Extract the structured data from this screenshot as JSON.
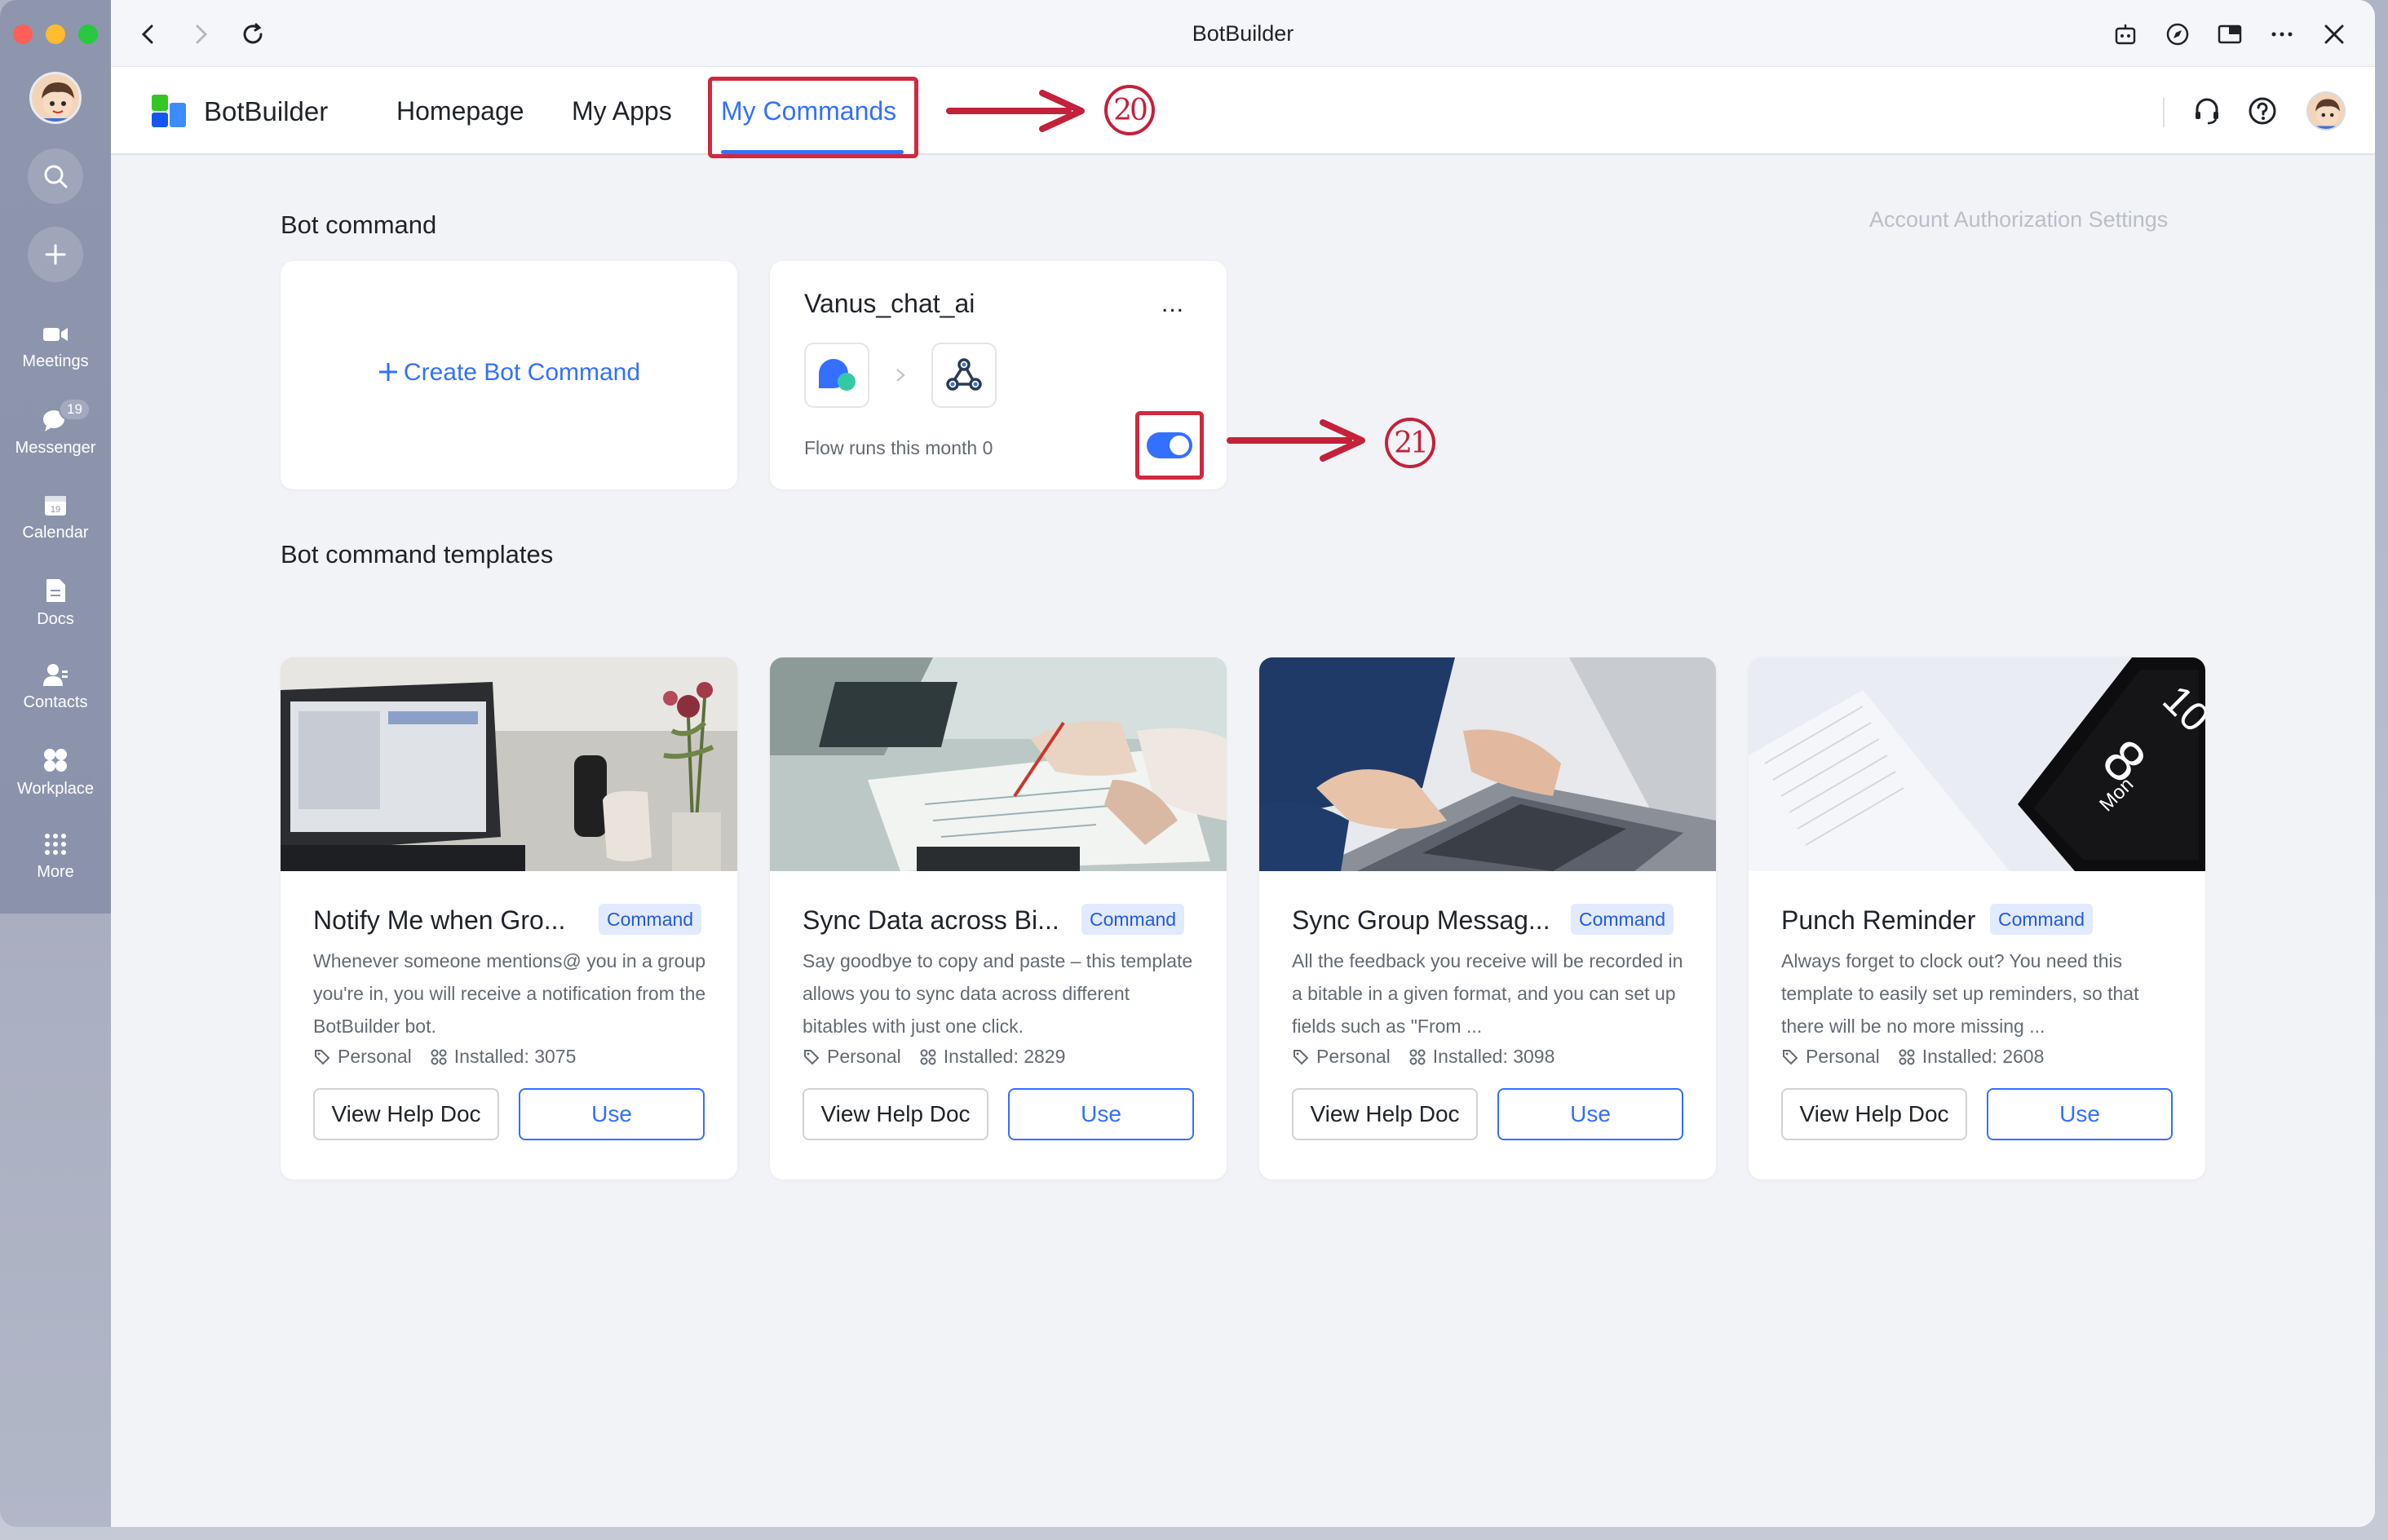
{
  "window": {
    "title": "BotBuilder"
  },
  "sidebar": {
    "items": [
      {
        "label": "Meetings",
        "icon": "video-icon"
      },
      {
        "label": "Messenger",
        "icon": "chat-icon",
        "badge": "19"
      },
      {
        "label": "Calendar",
        "icon": "calendar-icon",
        "day": "19"
      },
      {
        "label": "Docs",
        "icon": "docs-icon"
      },
      {
        "label": "Contacts",
        "icon": "contacts-icon"
      },
      {
        "label": "Workplace",
        "icon": "workplace-icon"
      },
      {
        "label": "More",
        "icon": "more-grid-icon"
      }
    ]
  },
  "header": {
    "brand": "BotBuilder",
    "nav": [
      {
        "label": "Homepage",
        "active": false
      },
      {
        "label": "My Apps",
        "active": false
      },
      {
        "label": "My Commands",
        "active": true
      }
    ]
  },
  "annotations": [
    "20",
    "21"
  ],
  "bot_command": {
    "title": "Bot command",
    "auth_link": "Account Authorization Settings",
    "create_label": "Create Bot Command",
    "commands": [
      {
        "name": "Vanus_chat_ai",
        "more": "...",
        "flow_text": "Flow runs this month 0",
        "enabled": true
      }
    ]
  },
  "templates": {
    "title": "Bot command templates",
    "help_label": "View Help Doc",
    "use_label": "Use",
    "tag": "Command",
    "items": [
      {
        "title": "Notify Me when Gro...",
        "desc": "Whenever someone mentions@ you in a group you're in, you will receive a notification from the BotBuilder bot.",
        "scope": "Personal",
        "installed": "Installed: 3075"
      },
      {
        "title": "Sync Data across Bi...",
        "desc": "Say goodbye to copy and paste – this template allows you to sync data across different bitables with just one click.",
        "scope": "Personal",
        "installed": "Installed: 2829"
      },
      {
        "title": "Sync Group Messag...",
        "desc": "All the feedback you receive will be recorded in a bitable in a given format, and you can set up fields such as \"From ...",
        "scope": "Personal",
        "installed": "Installed: 3098"
      },
      {
        "title": "Punch Reminder",
        "desc": "Always forget to clock out? You need this template to easily set up reminders, so that there will be no more missing ...",
        "scope": "Personal",
        "installed": "Installed: 2608"
      }
    ]
  },
  "colors": {
    "accent": "#3370ff",
    "annotation": "#d0293f",
    "tag_bg": "#e1eaff"
  }
}
